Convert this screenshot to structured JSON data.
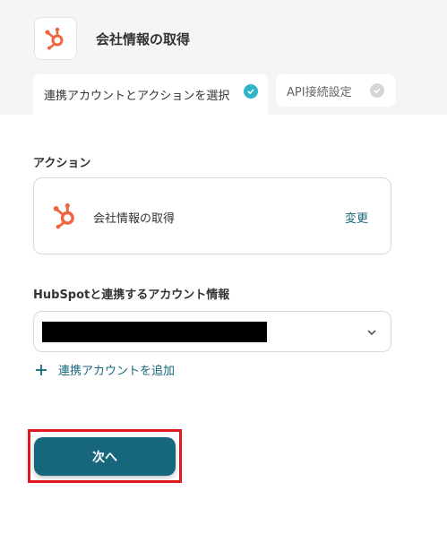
{
  "header": {
    "app_title": "会社情報の取得",
    "app_icon": "hubspot-icon"
  },
  "tabs": [
    {
      "label": "連携アカウントとアクションを選択",
      "active": true,
      "status_color": "#2bb5c7"
    },
    {
      "label": "API接続設定",
      "active": false,
      "status_color": "#d6d6d6"
    }
  ],
  "action_section": {
    "label": "アクション",
    "action_name": "会社情報の取得",
    "change_label": "変更"
  },
  "account_section": {
    "label": "HubSpotと連携するアカウント情報",
    "selected_value": "",
    "add_account_label": "連携アカウントを追加"
  },
  "footer": {
    "next_label": "次へ"
  },
  "colors": {
    "accent": "#16667c",
    "hubspot_orange": "#f0653f",
    "highlight": "#e0191f"
  }
}
